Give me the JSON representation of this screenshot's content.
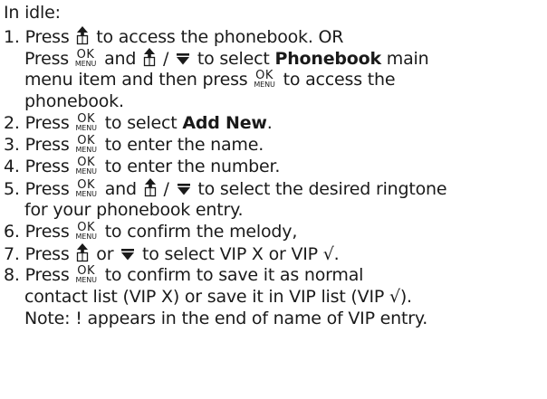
{
  "intro": "In idle:",
  "keys": {
    "ok_top": "OK",
    "ok_bottom": "MENU"
  },
  "icons": {
    "phonebook_up": "phonebook-up-icon",
    "down": "down-arrow-icon"
  },
  "steps": [
    {
      "number": "1.",
      "line1_a": "Press",
      "line1_b": "to access the phonebook. OR",
      "line2_a": "Press",
      "line2_b": "and",
      "line2_c": "/",
      "line2_d": "to select",
      "line2_bold": "Phonebook",
      "line2_e": "main",
      "line3_a": "menu item and then press",
      "line3_b": "to access the",
      "line4": "phonebook."
    },
    {
      "number": "2.",
      "a": "Press",
      "b": "to select",
      "bold": "Add New",
      "c": "."
    },
    {
      "number": "3.",
      "a": "Press",
      "b": "to enter the name."
    },
    {
      "number": "4.",
      "a": "Press",
      "b": "to enter the number."
    },
    {
      "number": "5.",
      "line1_a": "Press",
      "line1_b": "and",
      "line1_c": "/",
      "line1_d": "to select the desired ringtone",
      "line2": "for your phonebook entry."
    },
    {
      "number": "6.",
      "a": "Press",
      "b": "to confirm the melody,"
    },
    {
      "number": "7.",
      "a": "Press",
      "b": "or",
      "c": "to select VIP X or VIP √."
    },
    {
      "number": "8.",
      "line1_a": "Press",
      "line1_b": "to confirm to save it as normal",
      "line2": "contact list (VIP X) or save it in VIP list (VIP √).",
      "line3": "Note: ! appears in the end of name of VIP entry."
    }
  ]
}
